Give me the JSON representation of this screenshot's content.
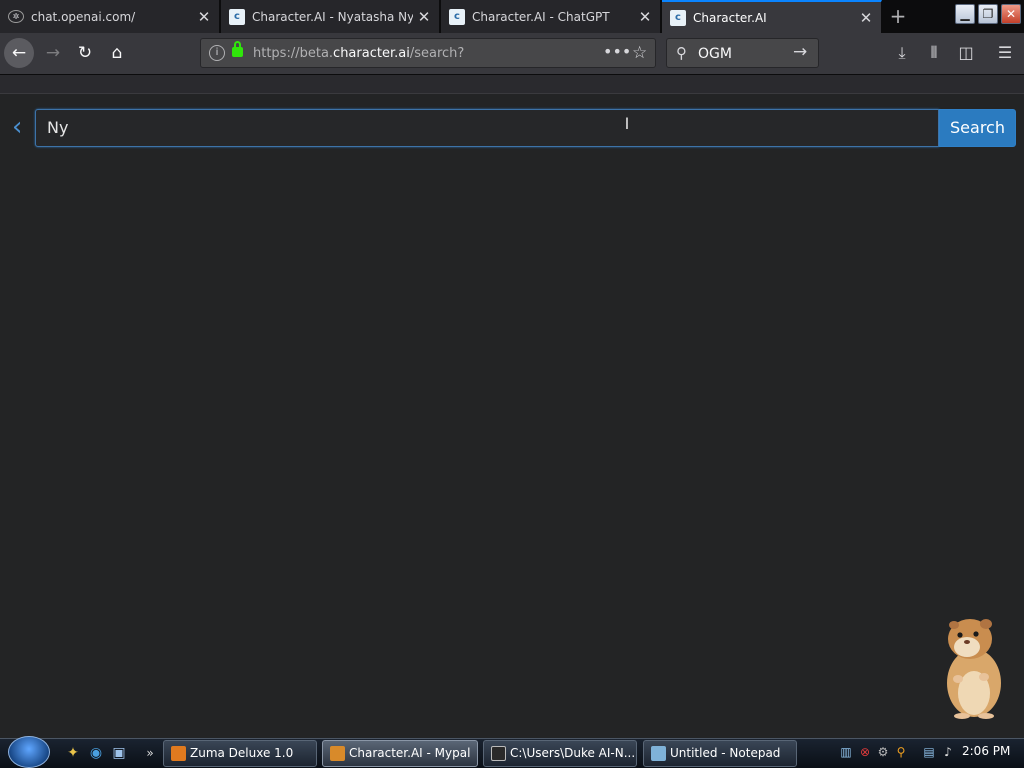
{
  "browser": {
    "tabs": [
      {
        "title": "chat.openai.com/",
        "favicon": "openai-icon"
      },
      {
        "title": "Character.AI - Nyatasha Nyanners",
        "favicon": "characterai-icon"
      },
      {
        "title": "Character.AI - ChatGPT",
        "favicon": "characterai-icon"
      },
      {
        "title": "Character.AI",
        "favicon": "characterai-icon",
        "active": true
      }
    ],
    "url": {
      "prefix": "https://beta.",
      "host": "character.ai",
      "path": "/search?"
    },
    "search_engine_query": "OGM"
  },
  "page": {
    "search_value": "Ny",
    "search_button": "Search"
  },
  "taskbar": {
    "tasks": [
      {
        "label": "Zuma Deluxe 1.0",
        "icon_color": "#e07a1f"
      },
      {
        "label": "Character.AI - Mypal",
        "icon_color": "#d88a2a",
        "active": true
      },
      {
        "label": "C:\\Users\\Duke AI-N...",
        "icon_color": "#2a2a2a"
      },
      {
        "label": "Untitled - Notepad",
        "icon_color": "#7fb2d8"
      }
    ],
    "clock": "2:06 PM"
  },
  "colors": {
    "accent": "#2b7bc0",
    "tab_active_border": "#0a84ff",
    "background": "#232425"
  }
}
